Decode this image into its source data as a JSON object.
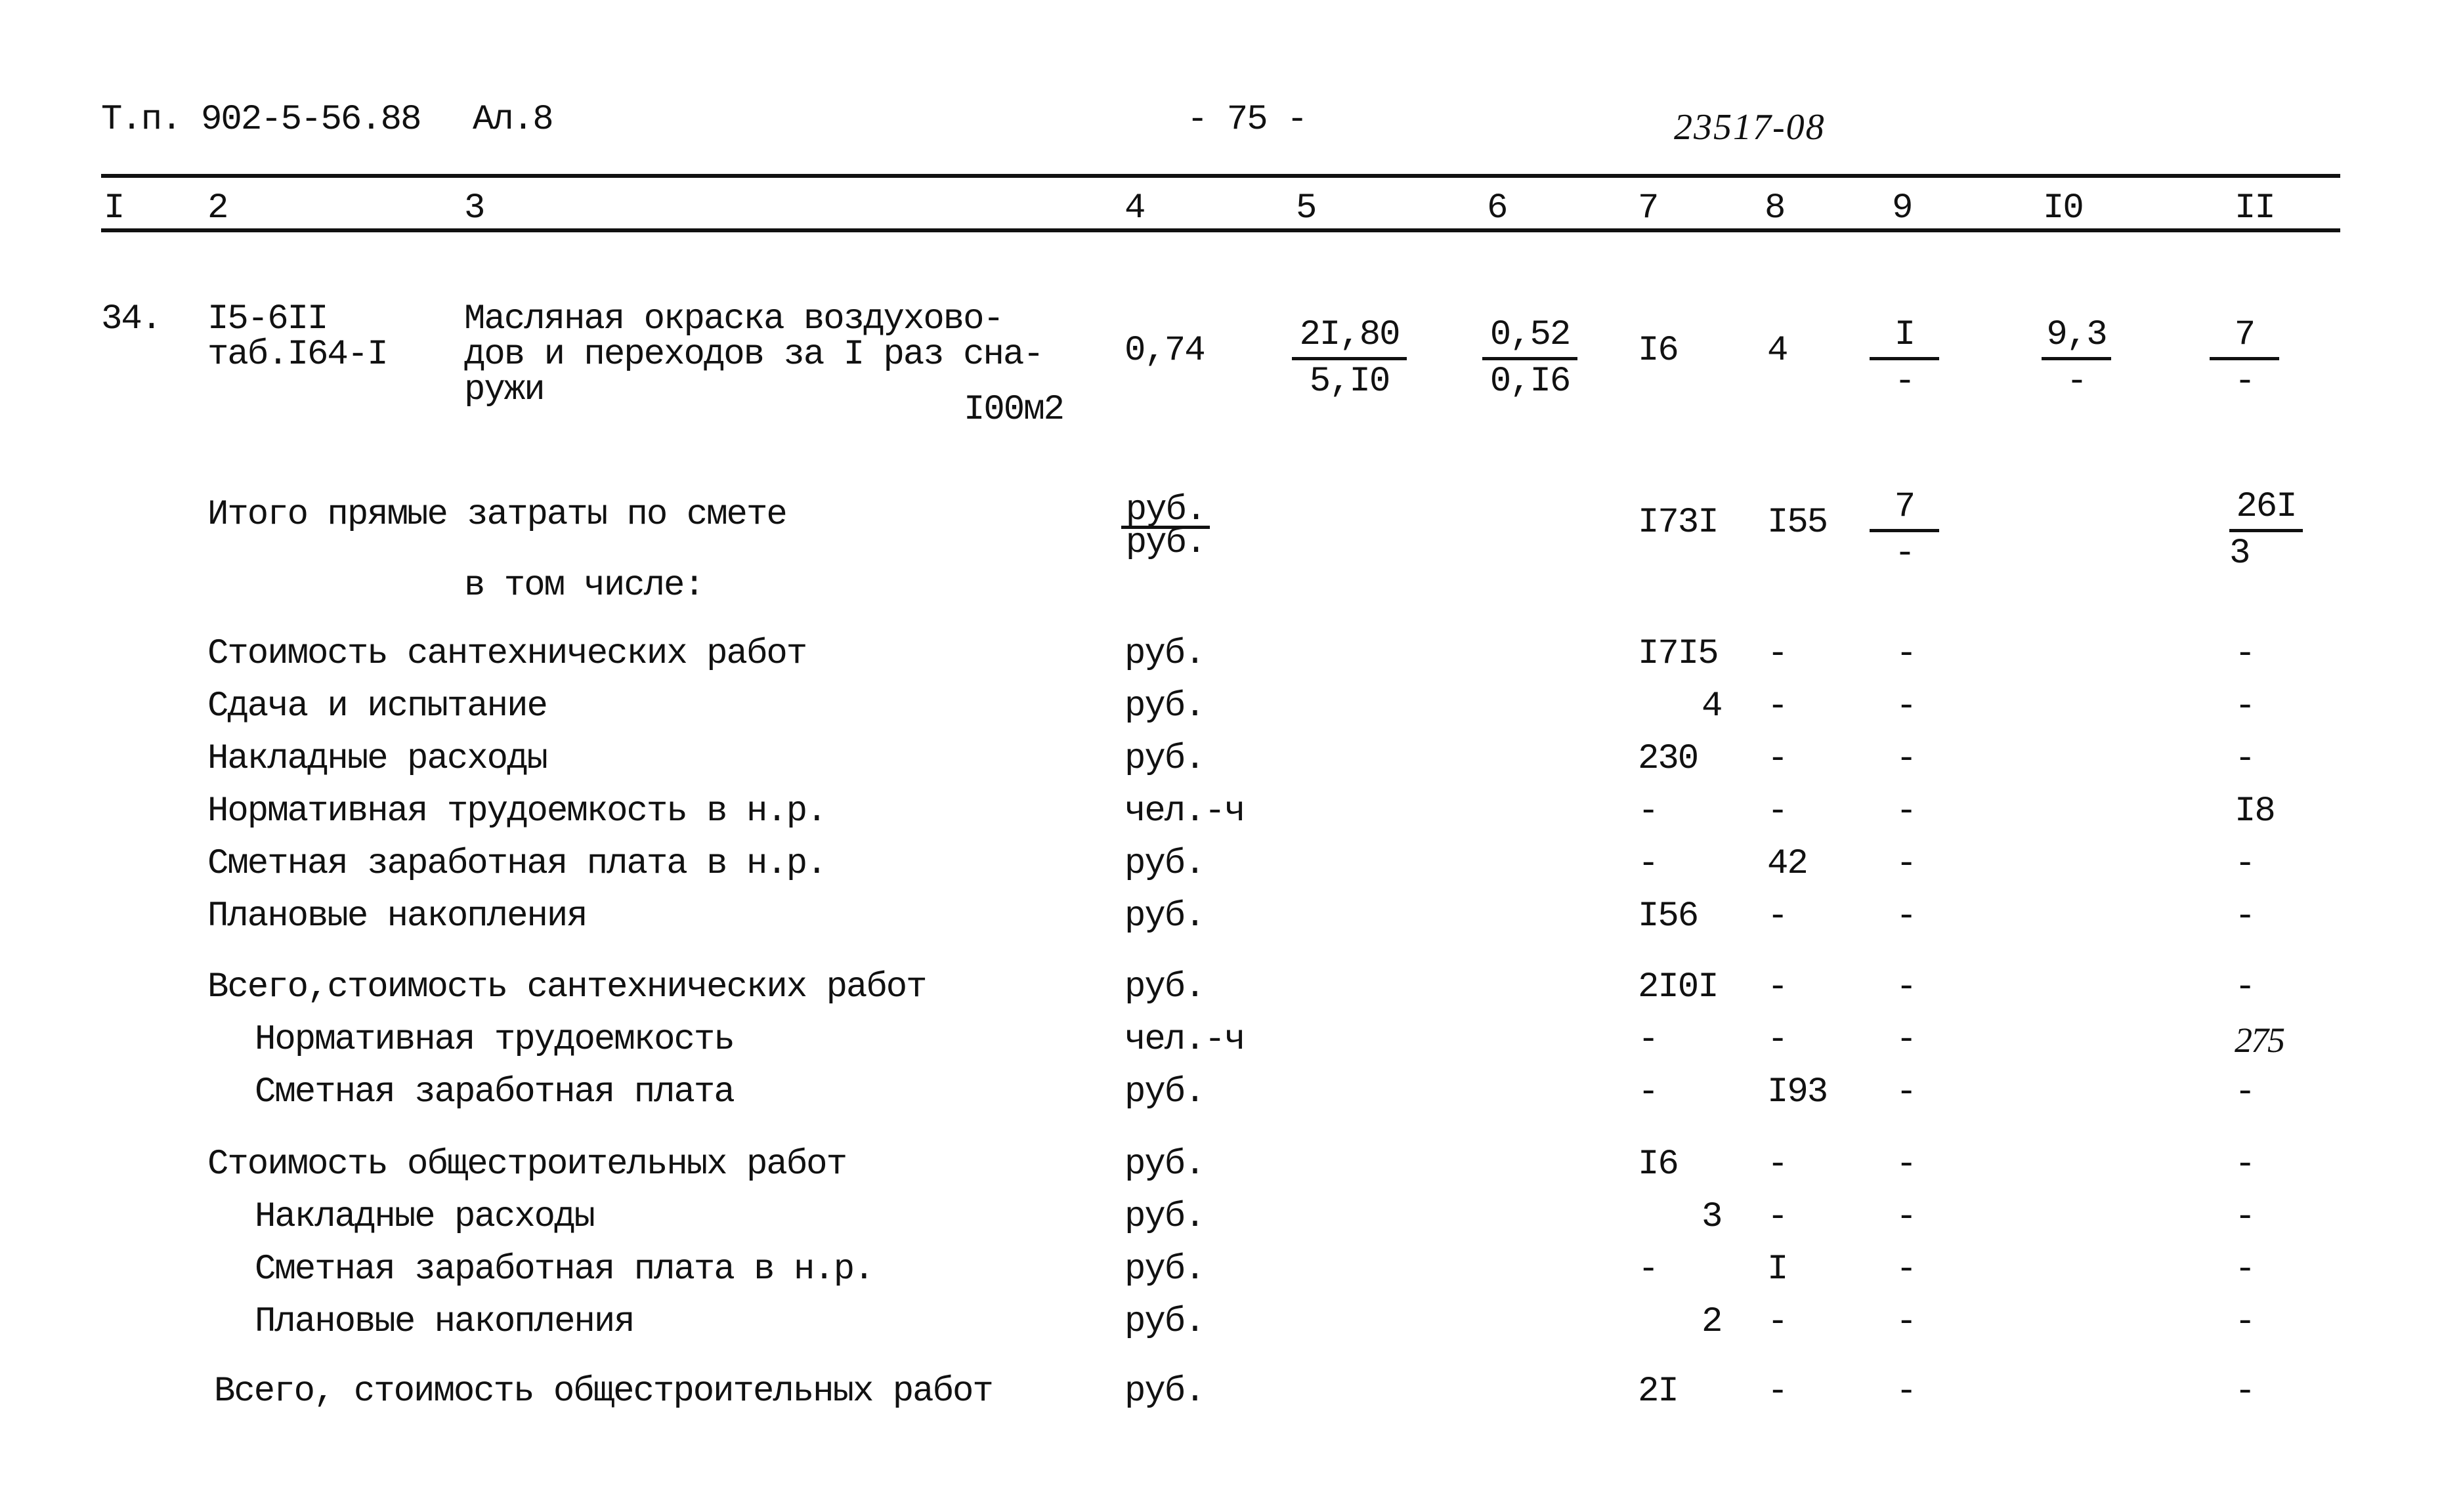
{
  "header": {
    "doc_ref": "Т.п. 902-5-56.88",
    "album": "Ал.8",
    "page_number": "- 75 -",
    "handwritten_code": "23517-08"
  },
  "columns": [
    "I",
    "2",
    "3",
    "4",
    "5",
    "6",
    "7",
    "8",
    "9",
    "I0",
    "II"
  ],
  "item": {
    "number": "34.",
    "code_line1": "I5-6II",
    "code_line2": "таб.I64-I",
    "description_lines": [
      "Масляная окраска воздухово-",
      "дов и переходов за I раз сна-",
      "ружи"
    ],
    "unit": "I00м2",
    "quantity": "0,74",
    "col5": {
      "top": "2I,80",
      "bottom": "5,I0"
    },
    "col6": {
      "top": "0,52",
      "bottom": "0,I6"
    },
    "col7": "I6",
    "col8": "4",
    "col9": {
      "top": "I",
      "bottom": "-"
    },
    "col10": {
      "top": "9,3",
      "bottom": "-"
    },
    "col11": {
      "top": "7",
      "bottom": "-"
    }
  },
  "total_direct": {
    "label": "Итого прямые затраты по смете",
    "unit": {
      "top": "руб.",
      "bottom": "руб."
    },
    "col7": "I73I",
    "col8": "I55",
    "col9": {
      "top": "7",
      "bottom": "-"
    },
    "col11": {
      "top": "26I",
      "bottom": "3"
    },
    "including_label": "в том числе:"
  },
  "rows": [
    {
      "label": "Стоимость сантехнических работ",
      "unit": "руб.",
      "c7": "I7I5",
      "c8": "-",
      "c9": "-",
      "c11": "-"
    },
    {
      "label": "Сдача и испытание",
      "unit": "руб.",
      "c7": "4",
      "c8": "-",
      "c9": "-",
      "c11": "-"
    },
    {
      "label": "Накладные расходы",
      "unit": "руб.",
      "c7": "230",
      "c8": "-",
      "c9": "-",
      "c11": "-"
    },
    {
      "label": "Нормативная трудоемкость в н.р.",
      "unit": "чел.-ч",
      "c7": "-",
      "c8": "-",
      "c9": "-",
      "c11": "I8"
    },
    {
      "label": "Сметная заработная плата в н.р.",
      "unit": "руб.",
      "c7": "-",
      "c8": "42",
      "c9": "-",
      "c11": "-"
    },
    {
      "label": "Плановые накопления",
      "unit": "руб.",
      "c7": "I56",
      "c8": "-",
      "c9": "-",
      "c11": "-"
    },
    {
      "label": "Всего,стоимость сантехнических работ",
      "unit": "руб.",
      "c7": "2I0I",
      "c8": "-",
      "c9": "-",
      "c11": "-"
    },
    {
      "label": "Нормативная трудоемкость",
      "unit": "чел.-ч",
      "c7": "-",
      "c8": "-",
      "c9": "-",
      "c11": "275"
    },
    {
      "label": "Сметная заработная плата",
      "unit": "руб.",
      "c7": "-",
      "c8": "I93",
      "c9": "-",
      "c11": "-"
    },
    {
      "label": "Стоимость общестроительных работ",
      "unit": "руб.",
      "c7": "I6",
      "c8": "-",
      "c9": "-",
      "c11": "-"
    },
    {
      "label": "Накладные расходы",
      "unit": "руб.",
      "c7": "3",
      "c8": "-",
      "c9": "-",
      "c11": "-"
    },
    {
      "label": "Сметная заработная плата в н.р.",
      "unit": "руб.",
      "c7": "-",
      "c8": "I",
      "c9": "-",
      "c11": "-"
    },
    {
      "label": "Плановые накопления",
      "unit": "руб.",
      "c7": "2",
      "c8": "-",
      "c9": "-",
      "c11": "-"
    },
    {
      "label": "Всего, стоимость общестроительных работ",
      "unit": "руб.",
      "c7": "2I",
      "c8": "-",
      "c9": "-",
      "c11": "-"
    }
  ]
}
